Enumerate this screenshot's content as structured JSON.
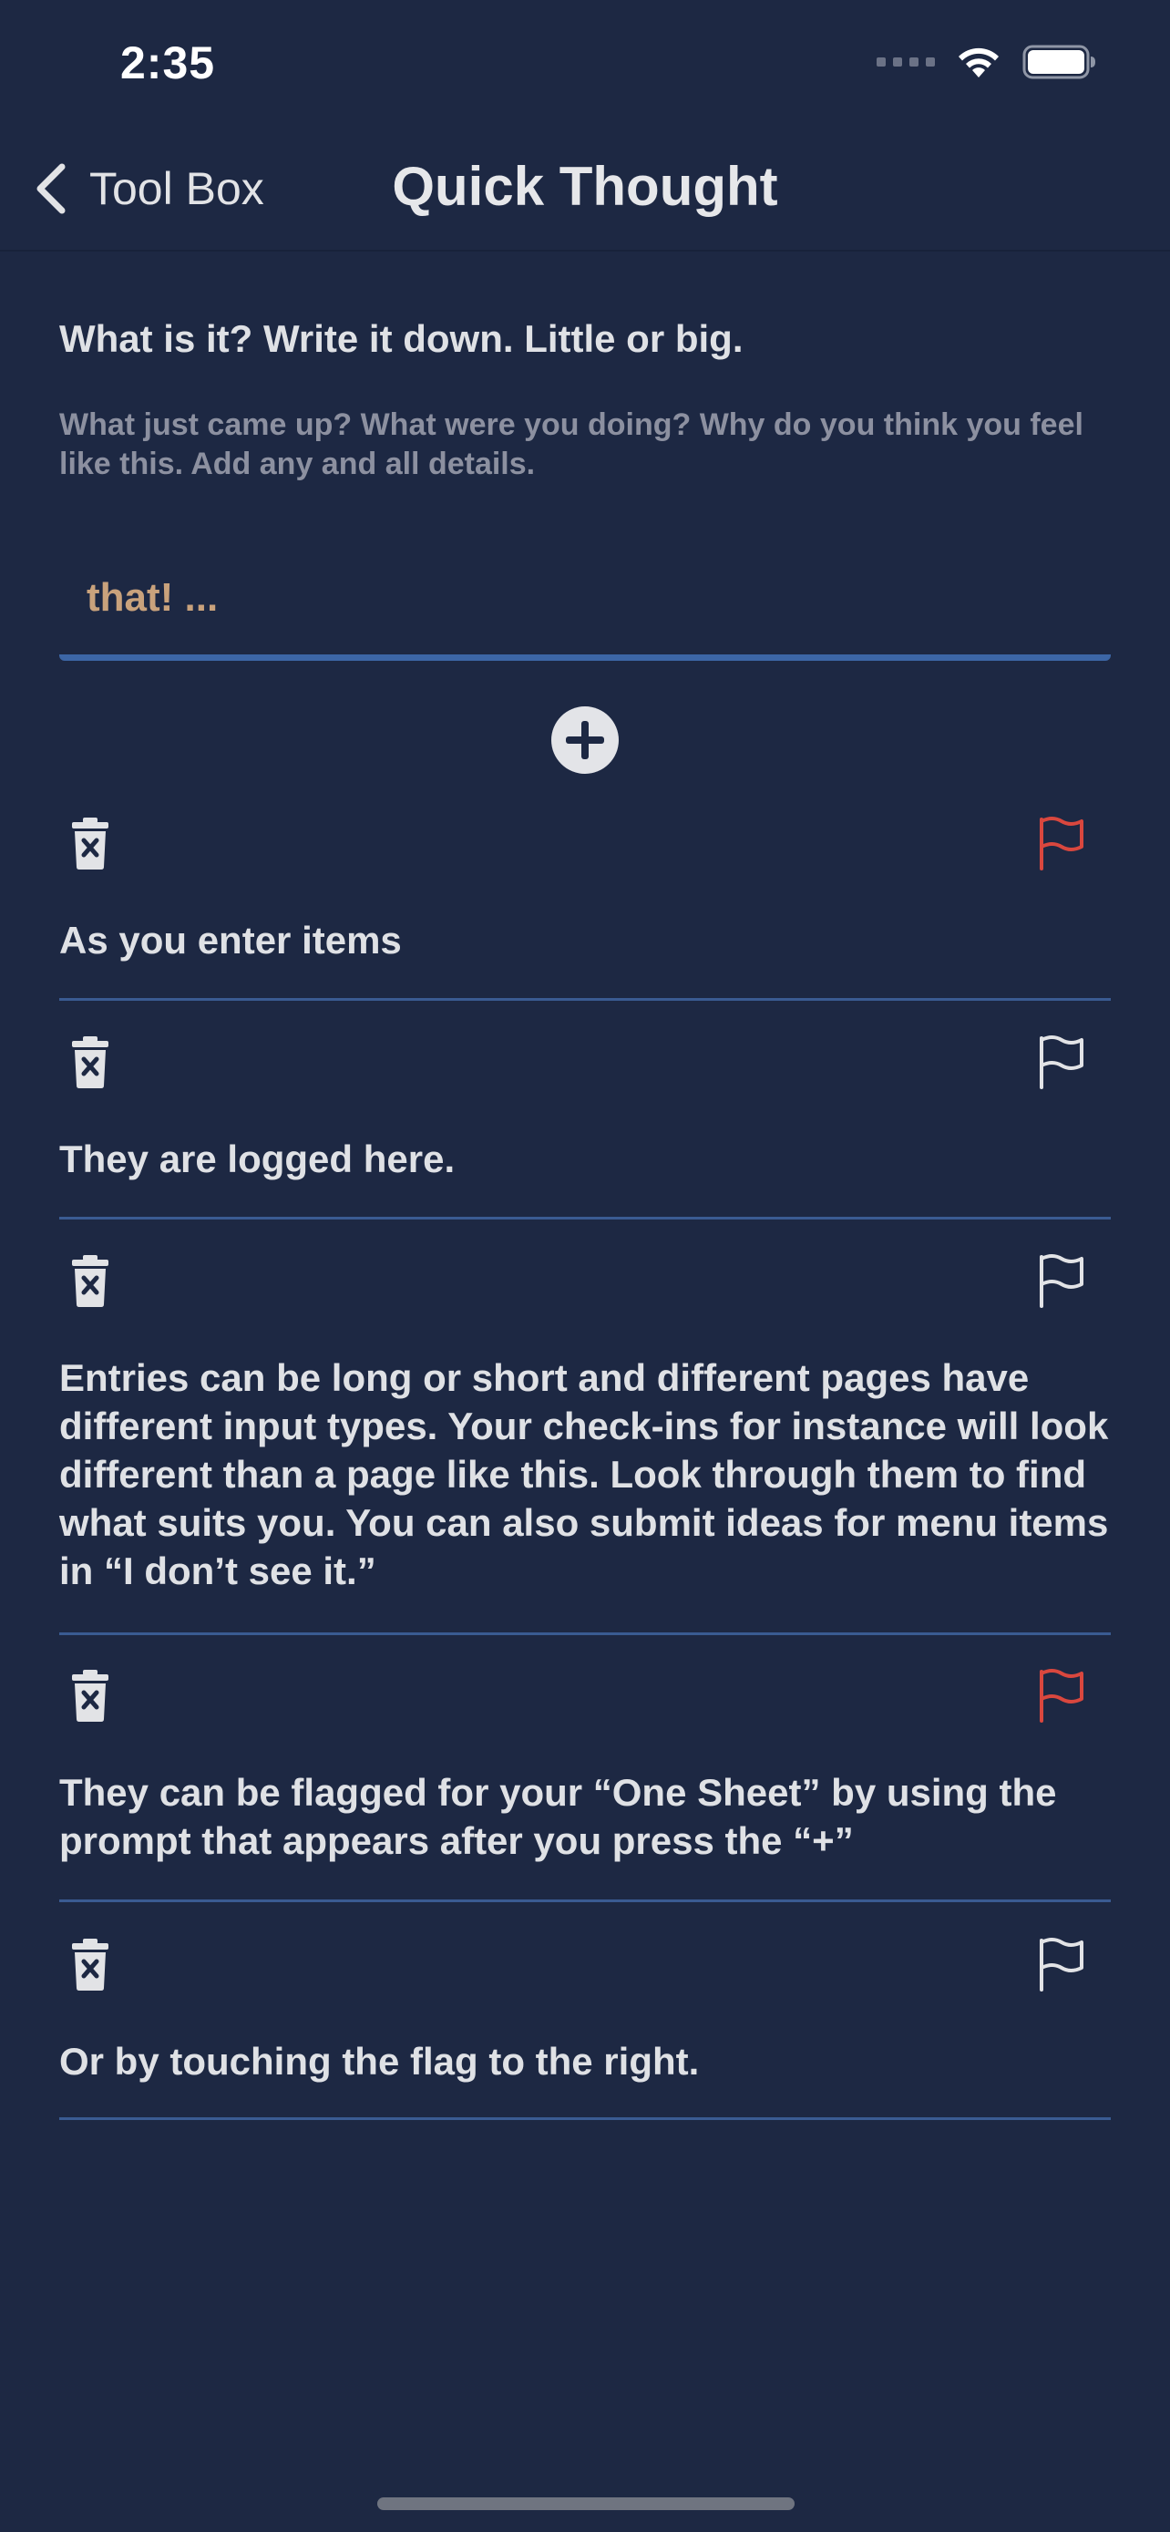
{
  "status_bar": {
    "time": "2:35",
    "icons": [
      "cellular-signal-icon",
      "wifi-icon",
      "battery-icon"
    ]
  },
  "nav": {
    "back_label": "Tool Box",
    "title": "Quick Thought"
  },
  "prompt": {
    "heading": "What is it? Write it down. Little or big.",
    "subtext": "What just came up? What were you doing? Why do you think you feel like this. Add any and all details."
  },
  "input": {
    "value": "that! ..."
  },
  "colors": {
    "background": "#1d2843",
    "text": "#dfe1e5",
    "muted_text": "#8c90a0",
    "input_text": "#c9a27c",
    "accent_line": "#3c66a6",
    "divider": "#3a5b92",
    "flag_active": "#d9473e",
    "flag_inactive": "#e2e3e6"
  },
  "entries": [
    {
      "text": "As you enter items",
      "flagged": true
    },
    {
      "text": "They are logged here.",
      "flagged": false
    },
    {
      "text": "Entries can be long or short and different pages have different input types. Your check-ins for instance will look different than a page like this. Look through them to find what suits you. You can also submit ideas for menu items in “I don’t see it.”",
      "flagged": false
    },
    {
      "text": "They can be flagged for your “One Sheet” by using the prompt that appears after you press the “+”",
      "flagged": true
    },
    {
      "text": "Or by touching the flag to the right.",
      "flagged": false
    }
  ]
}
